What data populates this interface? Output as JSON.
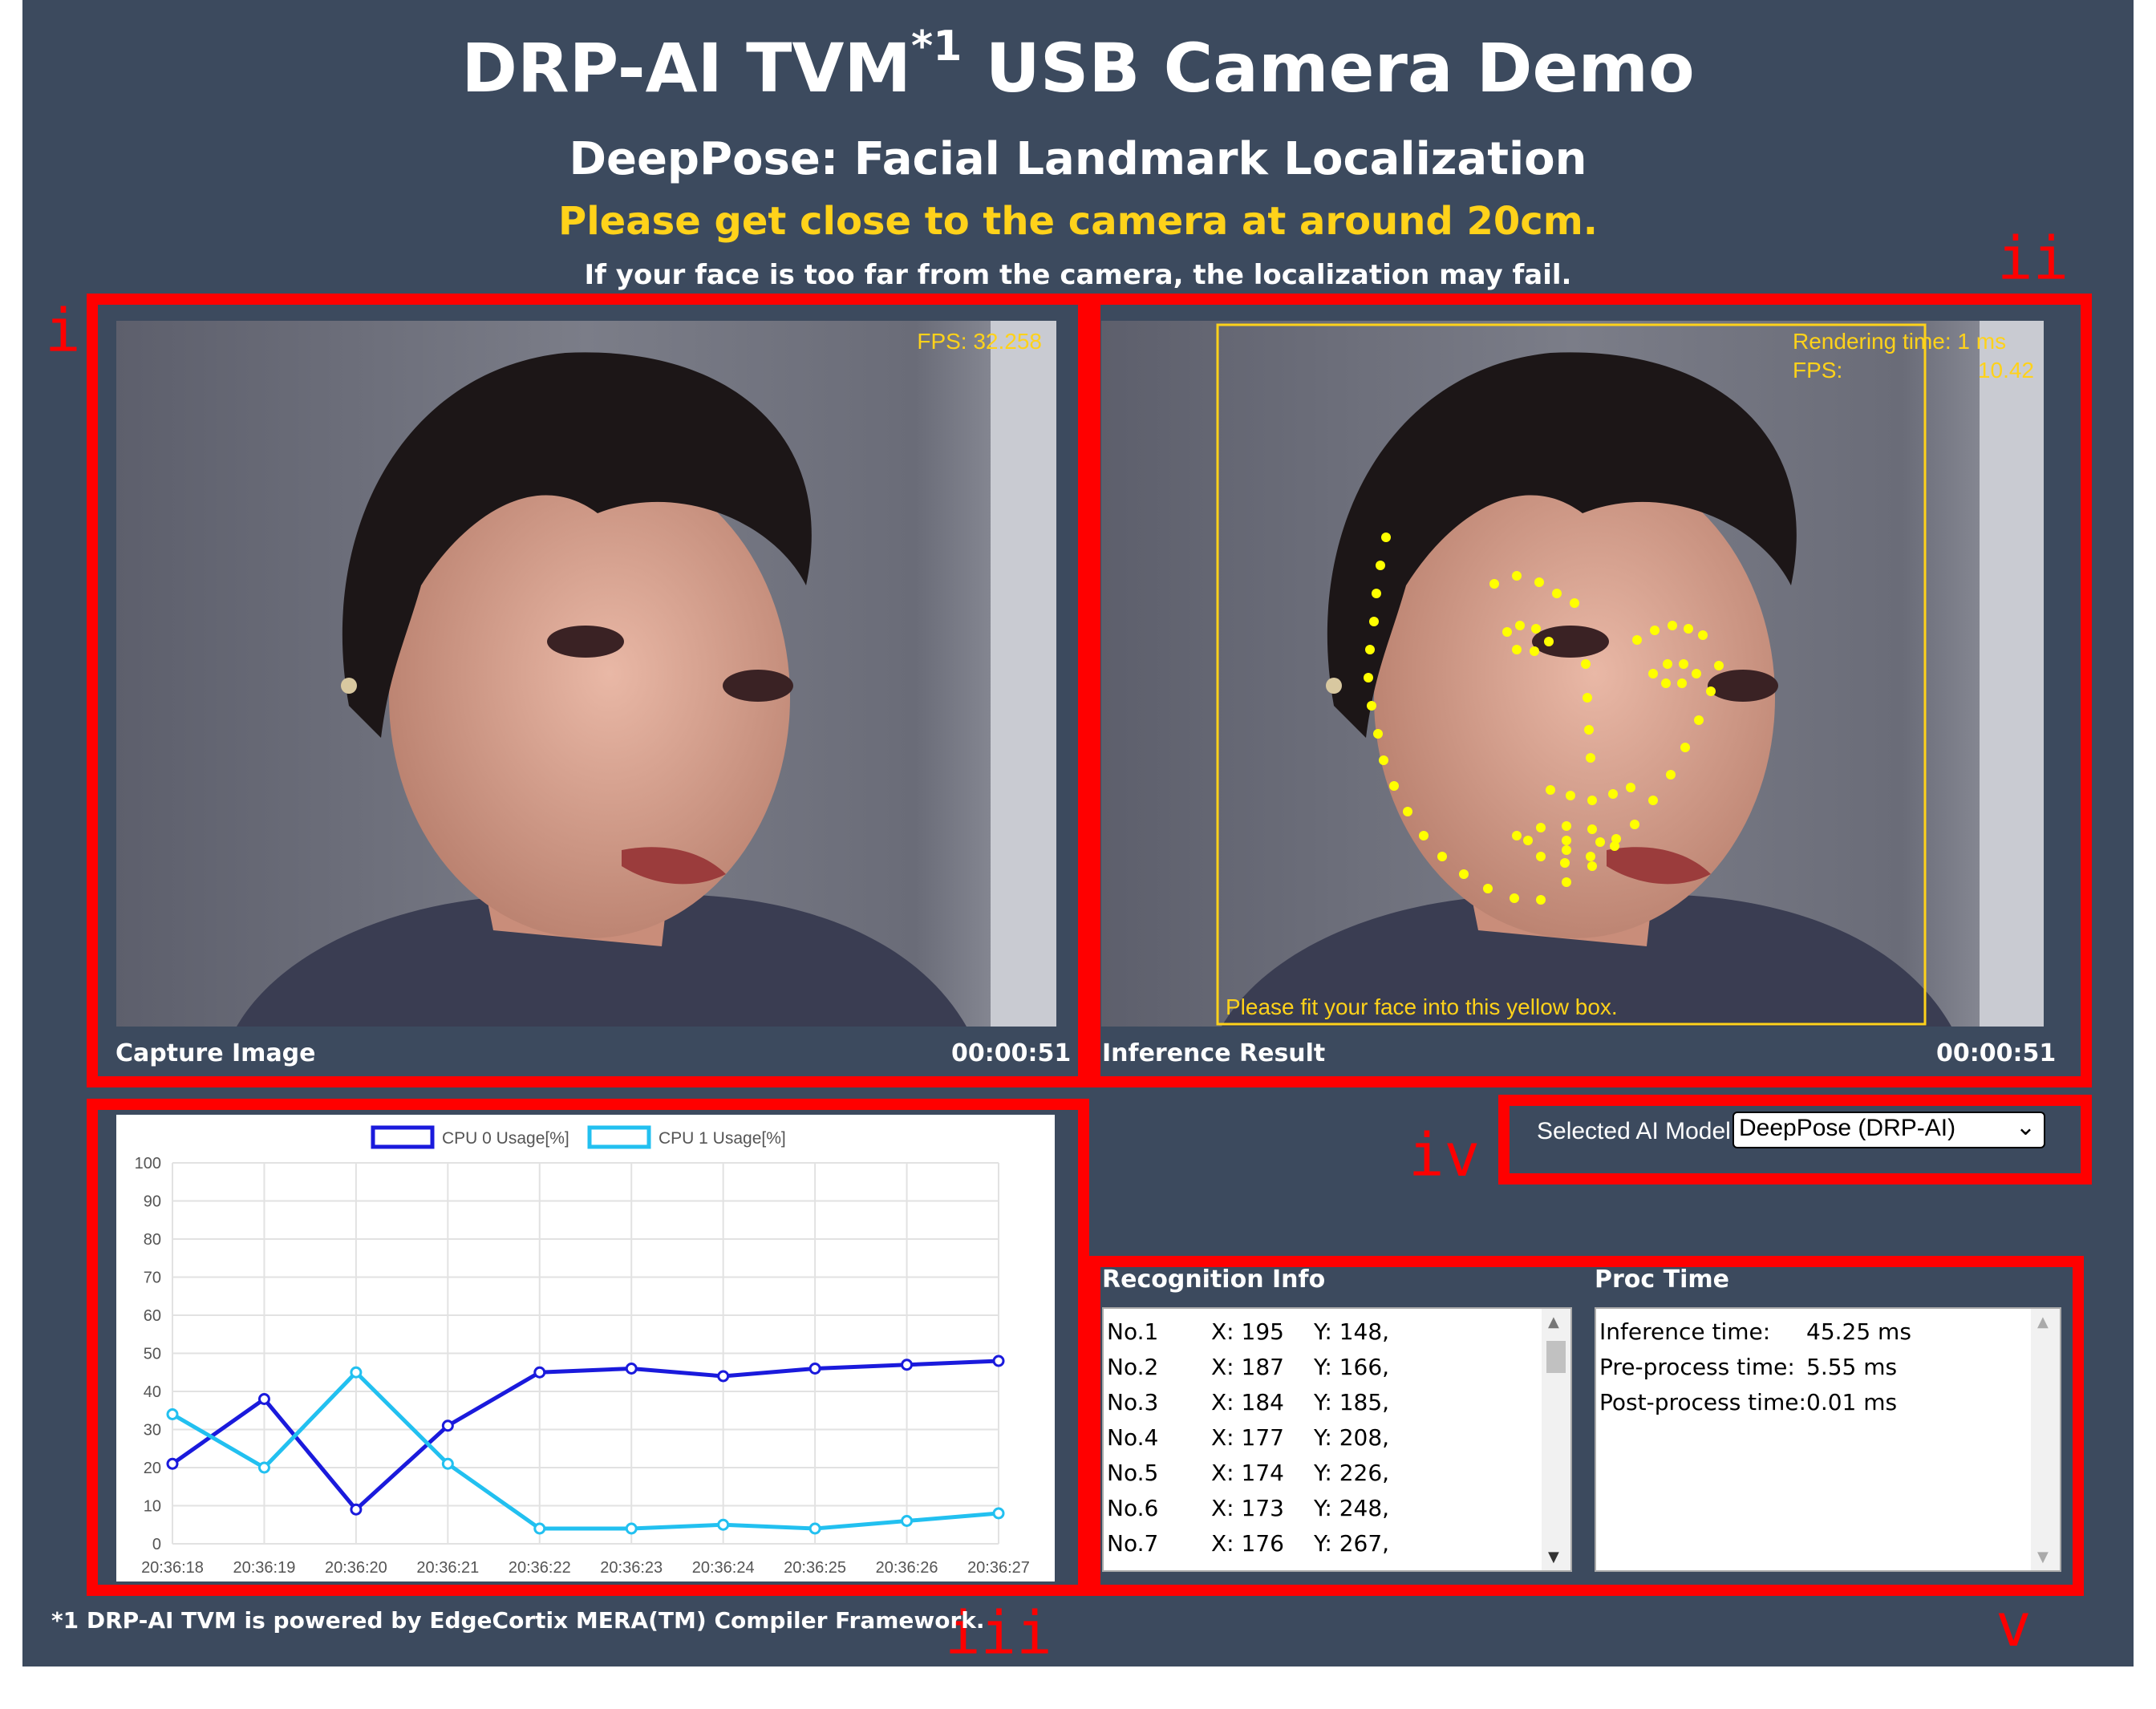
{
  "header": {
    "title": "DRP-AI TVM",
    "title_sup": "*1",
    "title_rest": "USB Camera Demo",
    "subtitle": "DeepPose: Facial Landmark Localization",
    "instruction": "Please get close to the camera at around 20cm.",
    "note": "If your face is too far from the camera, the localization may fail."
  },
  "annotations": {
    "i": "i",
    "ii": "ii",
    "iii": "iii",
    "iv": "iv",
    "v": "v"
  },
  "capture": {
    "fps_text": "FPS: 32.258",
    "label": "Capture Image",
    "time": "00:00:51"
  },
  "inference": {
    "rendering_text": "Rendering time: 1 ms",
    "fps_label": "FPS:",
    "fps_value": "10.42",
    "hint": "Please fit your face into this yellow box.",
    "label": "Inference Result",
    "time": "00:00:51"
  },
  "model": {
    "label": "Selected AI Model",
    "selected": "DeepPose (DRP-AI)"
  },
  "recognition": {
    "title": "Recognition Info",
    "rows": [
      {
        "no": "No.1",
        "x": "X: 195",
        "y": "Y: 148,"
      },
      {
        "no": "No.2",
        "x": "X: 187",
        "y": "Y: 166,"
      },
      {
        "no": "No.3",
        "x": "X: 184",
        "y": "Y: 185,"
      },
      {
        "no": "No.4",
        "x": "X: 177",
        "y": "Y: 208,"
      },
      {
        "no": "No.5",
        "x": "X: 174",
        "y": "Y: 226,"
      },
      {
        "no": "No.6",
        "x": "X: 173",
        "y": "Y: 248,"
      },
      {
        "no": "No.7",
        "x": "X: 176",
        "y": "Y: 267,"
      }
    ]
  },
  "proc_time": {
    "title": "Proc Time",
    "rows": [
      {
        "label": "Inference time:",
        "value": "45.25 ms"
      },
      {
        "label": "Pre-process time:",
        "value": "5.55 ms"
      },
      {
        "label": "Post-process time:",
        "value": "0.01 ms"
      }
    ]
  },
  "footnote": "*1 DRP-AI TVM is powered by EdgeCortix MERA(TM) Compiler Framework.",
  "chart_data": {
    "type": "line",
    "x": [
      "20:36:18",
      "20:36:19",
      "20:36:20",
      "20:36:21",
      "20:36:22",
      "20:36:23",
      "20:36:24",
      "20:36:25",
      "20:36:26",
      "20:36:27"
    ],
    "series": [
      {
        "name": "CPU 0 Usage[%]",
        "color": "#1a1adc",
        "values": [
          21,
          38,
          9,
          31,
          45,
          46,
          44,
          46,
          47,
          48
        ]
      },
      {
        "name": "CPU 1 Usage[%]",
        "color": "#22c0f0",
        "values": [
          34,
          20,
          45,
          21,
          4,
          4,
          5,
          4,
          6,
          8
        ]
      }
    ],
    "yticks": [
      "0",
      "10",
      "20",
      "30",
      "40",
      "50",
      "60",
      "70",
      "80",
      "90",
      "100"
    ],
    "ylim": [
      0,
      100
    ],
    "grid": true,
    "legend": "top"
  },
  "landmark_color": "#ffff00",
  "accent_red": "#ff0000"
}
